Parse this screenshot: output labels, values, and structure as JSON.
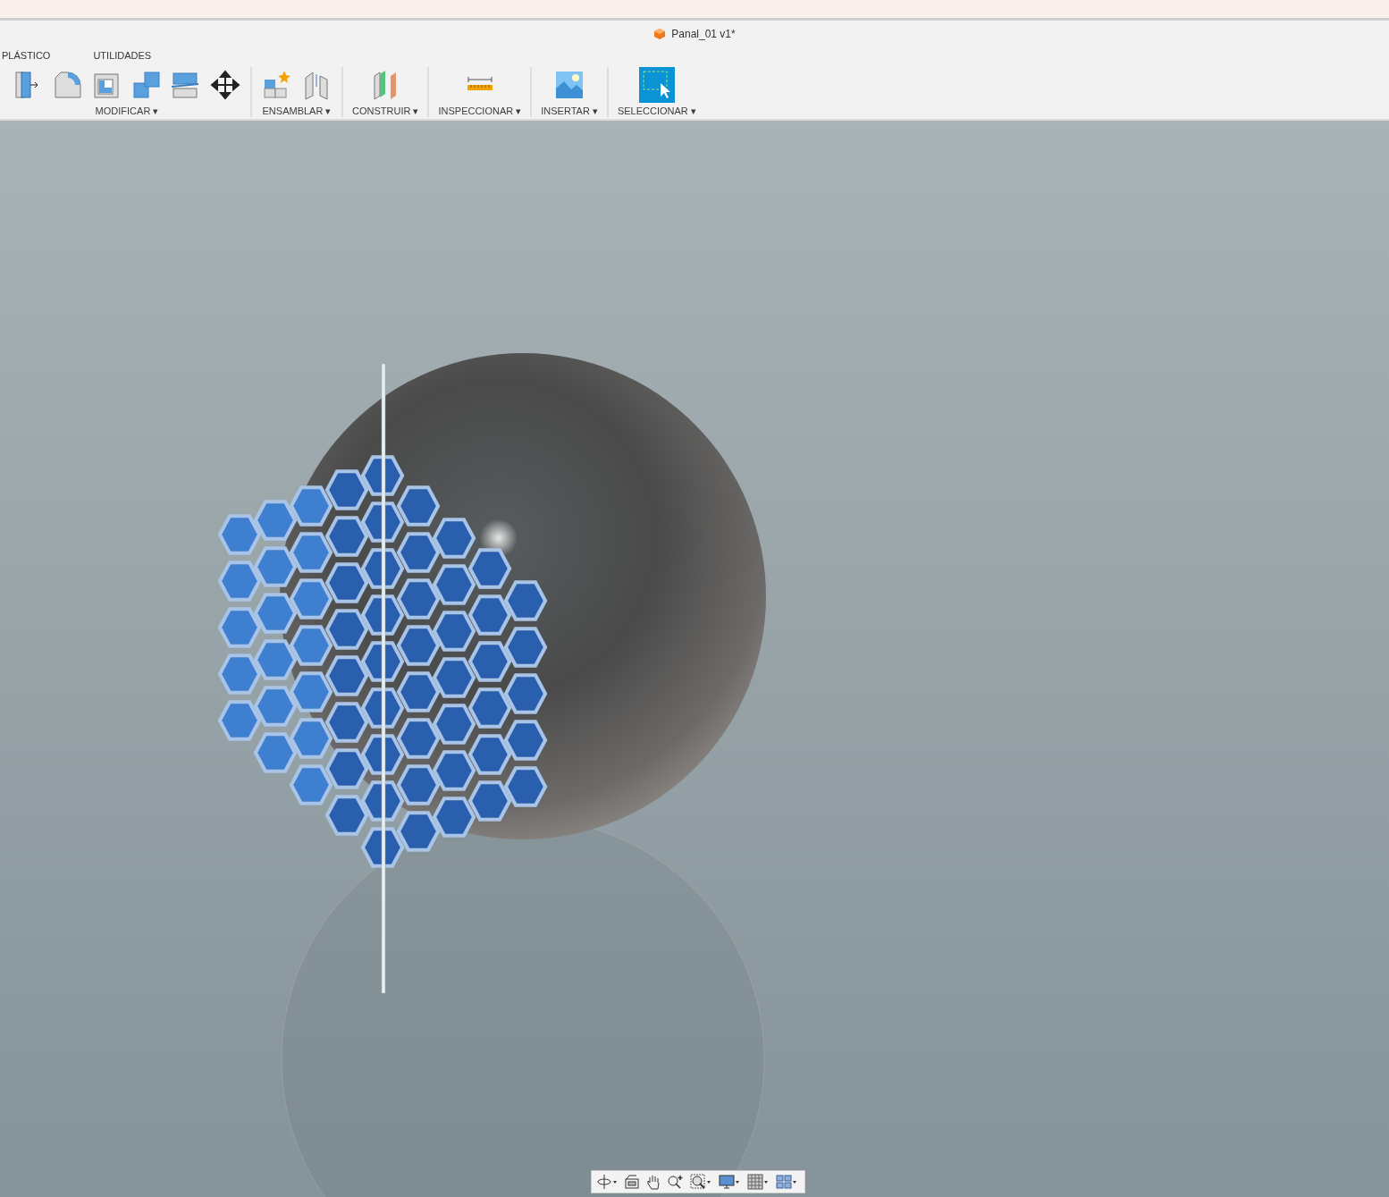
{
  "window": {
    "title": "Panal_01 v1*"
  },
  "tabs": [
    {
      "label": "PLÁSTICO"
    },
    {
      "label": "UTILIDADES"
    }
  ],
  "toolbar_groups": [
    {
      "label": "MODIFICAR ▾"
    },
    {
      "label": "ENSAMBLAR ▾"
    },
    {
      "label": "CONSTRUIR ▾"
    },
    {
      "label": "INSPECCIONAR ▾"
    },
    {
      "label": "INSERTAR ▾"
    },
    {
      "label": "SELECCIONAR ▾"
    }
  ]
}
